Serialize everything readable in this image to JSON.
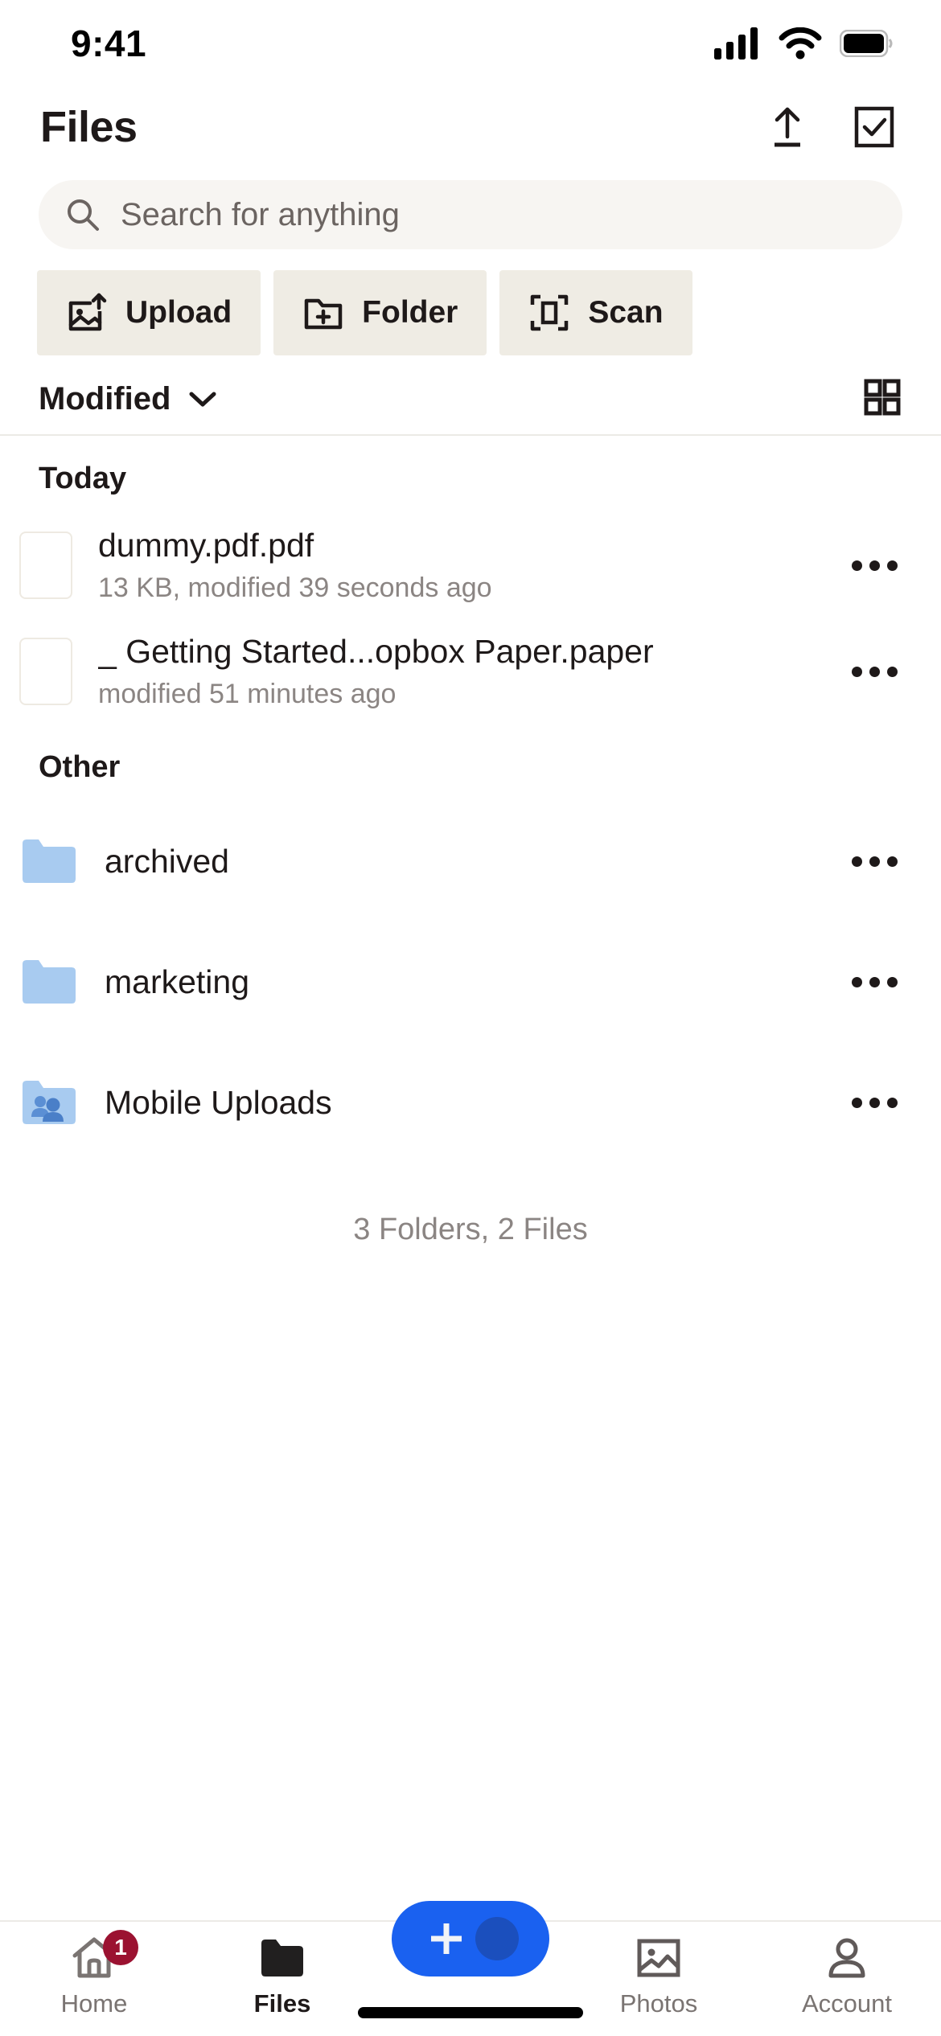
{
  "status_bar": {
    "time": "9:41",
    "icons": [
      "cellular-signal-icon",
      "wifi-icon",
      "battery-icon"
    ]
  },
  "header": {
    "title": "Files",
    "actions": [
      {
        "name": "upload-button",
        "icon": "upload-arrow-icon"
      },
      {
        "name": "select-button",
        "icon": "checkbox-check-icon"
      }
    ]
  },
  "search": {
    "placeholder": "Search for anything",
    "value": "",
    "icon": "search-icon"
  },
  "quick_actions": [
    {
      "label": "Upload",
      "icon": "image-upload-icon"
    },
    {
      "label": "Folder",
      "icon": "folder-plus-icon"
    },
    {
      "label": "Scan",
      "icon": "document-scan-icon"
    }
  ],
  "sort": {
    "label": "Modified",
    "chevron": "chevron-down-icon",
    "view_toggle_icon": "grid-view-icon"
  },
  "sections": [
    {
      "title": "Today",
      "items": [
        {
          "name": "dummy.pdf.pdf",
          "meta": "13 KB, modified 39 seconds ago",
          "kind": "file",
          "thumb": "file-thumbnail",
          "more": "overflow-menu-icon"
        },
        {
          "name": "_ Getting Started...opbox Paper.paper",
          "meta": "modified 51 minutes ago",
          "kind": "file",
          "thumb": "file-thumbnail",
          "more": "overflow-menu-icon"
        }
      ]
    },
    {
      "title": "Other",
      "items": [
        {
          "name": "archived",
          "meta": "",
          "kind": "folder",
          "icon": "folder-icon",
          "more": "overflow-menu-icon"
        },
        {
          "name": "marketing",
          "meta": "",
          "kind": "folder",
          "icon": "folder-icon",
          "more": "overflow-menu-icon"
        },
        {
          "name": "Mobile Uploads",
          "meta": "",
          "kind": "shared-folder",
          "icon": "shared-folder-icon",
          "more": "overflow-menu-icon"
        }
      ]
    }
  ],
  "summary": "3 Folders, 2 Files",
  "tabs": [
    {
      "label": "Home",
      "icon": "home-icon",
      "active": false,
      "badge": "1"
    },
    {
      "label": "Files",
      "icon": "folder-filled-icon",
      "active": true,
      "badge": ""
    },
    {
      "label": "Photos",
      "icon": "photos-icon",
      "active": false,
      "badge": ""
    },
    {
      "label": "Account",
      "icon": "person-icon",
      "active": false,
      "badge": ""
    }
  ],
  "fab": {
    "name": "create-button",
    "icon": "plus-icon"
  },
  "colors": {
    "accent_blue": "#1a61f0",
    "fab_dot_blue": "#1b4fbd",
    "folder_blue": "#a8cbf0",
    "chip_bg": "#efece4",
    "search_bg": "#f7f5f2",
    "badge_red": "#9b1231",
    "text_primary": "#1e1919",
    "text_secondary": "#8b8583"
  }
}
